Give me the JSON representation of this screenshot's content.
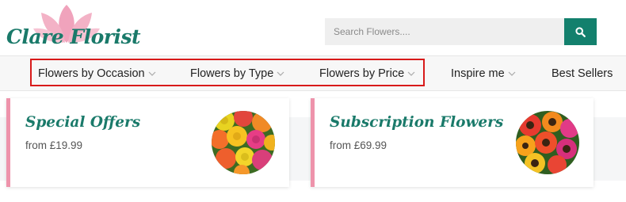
{
  "header": {
    "logo_text": "Clare Florist",
    "search_placeholder": "Search Flowers....",
    "search_button_icon": "search-icon",
    "brand_color": "#13806d",
    "logo_petal_color": "#f0a3bc"
  },
  "nav": {
    "items": [
      {
        "label": "Flowers by Occasion",
        "has_dropdown": true
      },
      {
        "label": "Flowers by Type",
        "has_dropdown": true
      },
      {
        "label": "Flowers by Price",
        "has_dropdown": true
      },
      {
        "label": "Inspire me",
        "has_dropdown": true
      },
      {
        "label": "Best Sellers",
        "has_dropdown": false
      }
    ],
    "highlight_color": "#d81a1a"
  },
  "cards": [
    {
      "title": "Special Offers",
      "price": "from £19.99"
    },
    {
      "title": "Subscription Flowers",
      "price": "from £69.99"
    }
  ],
  "colors": {
    "accent_green": "#1a7a6a",
    "card_border_pink": "#ee93ab"
  }
}
